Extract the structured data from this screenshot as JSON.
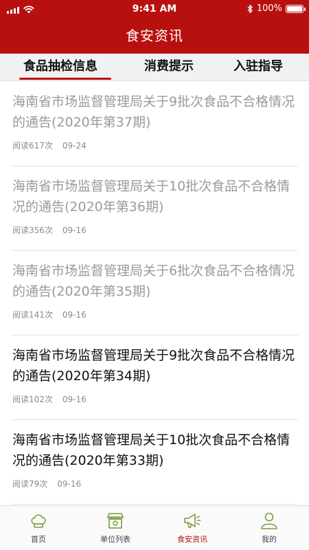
{
  "status_bar": {
    "time": "9:41 AM",
    "battery": "100%",
    "battery_level": 1.0
  },
  "header": {
    "title": "食安资讯"
  },
  "tabs": [
    {
      "label": "食品抽检信息",
      "active": true
    },
    {
      "label": "消费提示",
      "active": false
    },
    {
      "label": "入驻指导",
      "active": false
    }
  ],
  "articles": [
    {
      "title": "海南省市场监督管理局关于9批次食品不合格情况的通告(2020年第37期)",
      "reads": "阅读617次",
      "date": "09-24",
      "read_state": "read"
    },
    {
      "title": "海南省市场监督管理局关于10批次食品不合格情况的通告(2020年第36期)",
      "reads": "阅读356次",
      "date": "09-16",
      "read_state": "read"
    },
    {
      "title": "海南省市场监督管理局关于6批次食品不合格情况的通告(2020年第35期)",
      "reads": "阅读141次",
      "date": "09-16",
      "read_state": "read"
    },
    {
      "title": "海南省市场监督管理局关于9批次食品不合格情况的通告(2020年第34期)",
      "reads": "阅读102次",
      "date": "09-16",
      "read_state": "unread"
    },
    {
      "title": "海南省市场监督管理局关于10批次食品不合格情况的通告(2020年第33期)",
      "reads": "阅读79次",
      "date": "09-16",
      "read_state": "unread"
    }
  ],
  "tabbar": [
    {
      "label": "首页",
      "icon": "chef-hat-icon",
      "active": false
    },
    {
      "label": "单位列表",
      "icon": "storefront-icon",
      "active": false
    },
    {
      "label": "食安资讯",
      "icon": "megaphone-icon",
      "active": true
    },
    {
      "label": "我的",
      "icon": "user-icon",
      "active": false
    }
  ],
  "colors": {
    "brand": "#b8100f",
    "read_text": "#9a9a9a",
    "unread_text": "#111111",
    "tab_icon": "#7a9c3a"
  }
}
